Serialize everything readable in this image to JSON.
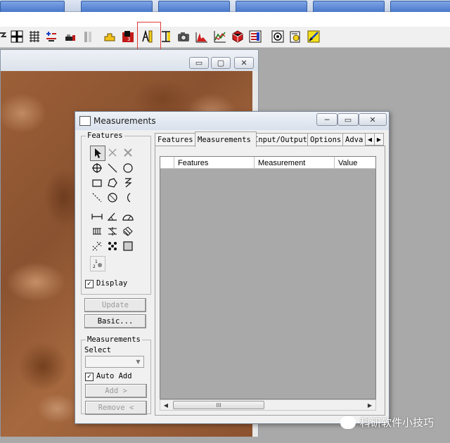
{
  "colors": {
    "accent_highlight": "#e03a3a",
    "grid_bg": "#a9a9a9",
    "dialog_bg": "#f0f0f0",
    "image_brown": "#9c6038"
  },
  "toolbar": {
    "icons": [
      "pointer-tool-icon",
      "grid-icon",
      "calculator-icon",
      "plus-minus-icon",
      "edit-icon",
      "bars-icon",
      "crop-icon",
      "filter-icon",
      "measure-icon",
      "scale-icon",
      "camera-icon",
      "histogram-icon",
      "line-profile-icon",
      "3d-cube-icon",
      "report-icon",
      "macro-icon",
      "script-icon",
      "annotate-icon"
    ]
  },
  "image_window": {
    "min_label": "▭",
    "max_label": "▢",
    "close_label": "✕"
  },
  "dialog": {
    "title": "Measurements",
    "min_label": "─",
    "max_label": "▭",
    "close_label": "✕",
    "features_group": {
      "legend": "Features",
      "display_label": "Display",
      "display_checked": true,
      "update_label": "Update",
      "basic_label": "Basic..."
    },
    "measurements_group": {
      "legend": "Measurements",
      "select_label": "Select",
      "auto_add_label": "Auto Add",
      "auto_add_checked": true,
      "add_label": "Add >",
      "remove_label": "Remove <"
    },
    "tabs": [
      {
        "label": "Features",
        "active": false
      },
      {
        "label": "Measurements",
        "active": true
      },
      {
        "label": "Input/Output",
        "active": false
      },
      {
        "label": "Options",
        "active": false
      },
      {
        "label": "Adva",
        "active": false
      }
    ],
    "table": {
      "columns": [
        "",
        "Features",
        "Measurement",
        "Value"
      ],
      "scroll_thumb": "III"
    }
  },
  "watermark": {
    "text": "科研软件小技巧"
  }
}
